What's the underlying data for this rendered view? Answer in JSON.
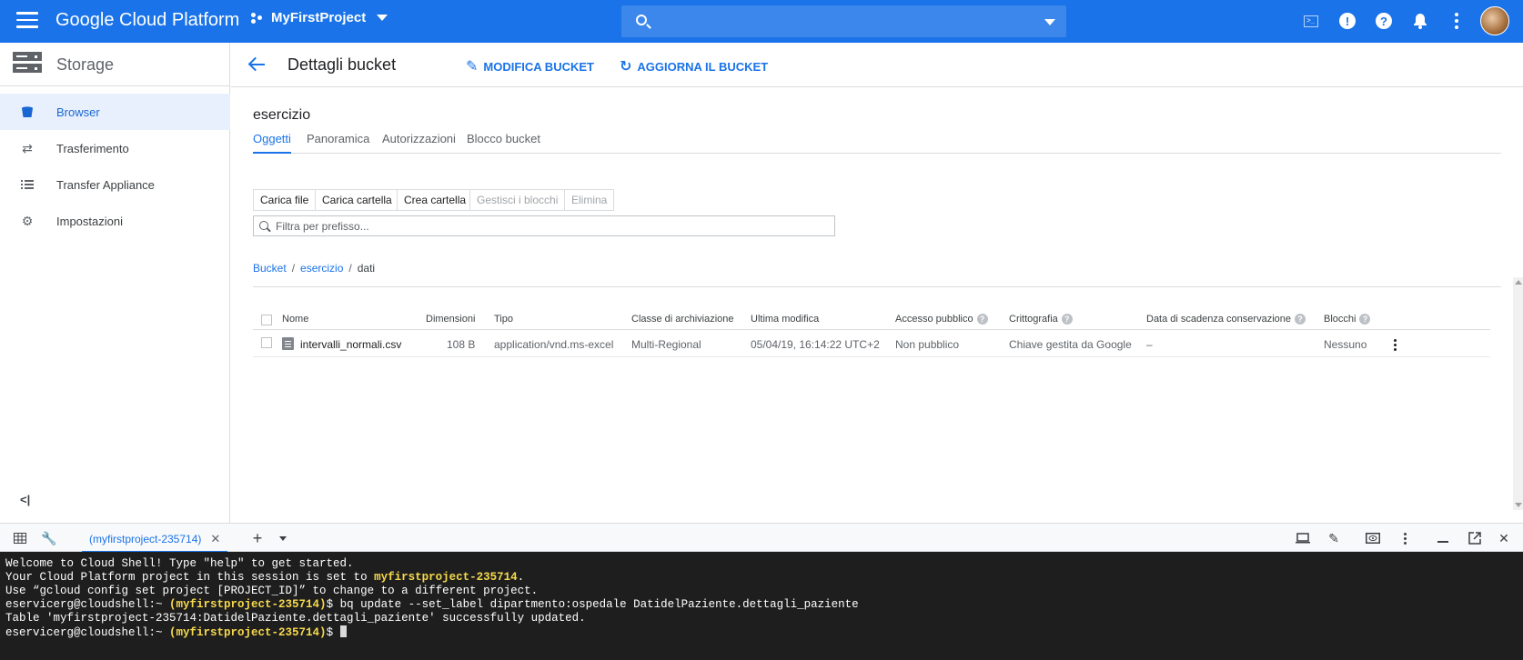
{
  "topbar": {
    "brand": "Google Cloud Platform",
    "project": "MyFirstProject",
    "search_placeholder": ""
  },
  "sidebar": {
    "title": "Storage",
    "items": [
      {
        "label": "Browser",
        "icon": "bucket-icon",
        "active": true
      },
      {
        "label": "Trasferimento",
        "icon": "swap-icon"
      },
      {
        "label": "Transfer Appliance",
        "icon": "list-icon"
      },
      {
        "label": "Impostazioni",
        "icon": "gear-icon"
      }
    ],
    "collapse_label": "<|"
  },
  "header": {
    "title": "Dettagli bucket",
    "edit_label": "MODIFICA BUCKET",
    "refresh_label": "AGGIORNA IL BUCKET"
  },
  "bucket": {
    "name": "esercizio",
    "tabs": [
      "Oggetti",
      "Panoramica",
      "Autorizzazioni",
      "Blocco bucket"
    ],
    "active_tab": "Oggetti"
  },
  "toolbar": {
    "upload_file": "Carica file",
    "upload_folder": "Carica cartella",
    "create_folder": "Crea cartella",
    "manage_locks": "Gestisci i blocchi",
    "delete": "Elimina"
  },
  "filter": {
    "placeholder": "Filtra per prefisso..."
  },
  "breadcrumb": [
    "Bucket",
    "esercizio",
    "dati"
  ],
  "table": {
    "headers": {
      "name": "Nome",
      "size": "Dimensioni",
      "type": "Tipo",
      "storage_class": "Classe di archiviazione",
      "modified": "Ultima modifica",
      "public_access": "Accesso pubblico",
      "encryption": "Crittografia",
      "retention": "Data di scadenza conservazione",
      "holds": "Blocchi"
    },
    "rows": [
      {
        "name": "intervalli_normali.csv",
        "size": "108 B",
        "type": "application/vnd.ms-excel",
        "storage_class": "Multi-Regional",
        "modified": "05/04/19, 16:14:22 UTC+2",
        "public_access": "Non pubblico",
        "encryption": "Chiave gestita da Google",
        "retention": "–",
        "holds": "Nessuno"
      }
    ]
  },
  "shell": {
    "tab_label": "(myfirstproject-235714)",
    "lines": {
      "l1": "Welcome to Cloud Shell! Type \"help\" to get started.",
      "l2_pre": "Your Cloud Platform project in this session is set to ",
      "l2_proj": "myfirstproject-235714",
      "l2_post": ".",
      "l3": "Use “gcloud config set project [PROJECT_ID]” to change to a different project.",
      "prompt_user": "eservicerg@cloudshell:~ ",
      "prompt_proj": "(myfirstproject-235714)",
      "prompt_end": "$ ",
      "cmd": "bq update --set_label dipartmento:ospedale DatidelPaziente.dettagli_paziente",
      "l5": "Table 'myfirstproject-235714:DatidelPaziente.dettagli_paziente' successfully updated."
    }
  }
}
